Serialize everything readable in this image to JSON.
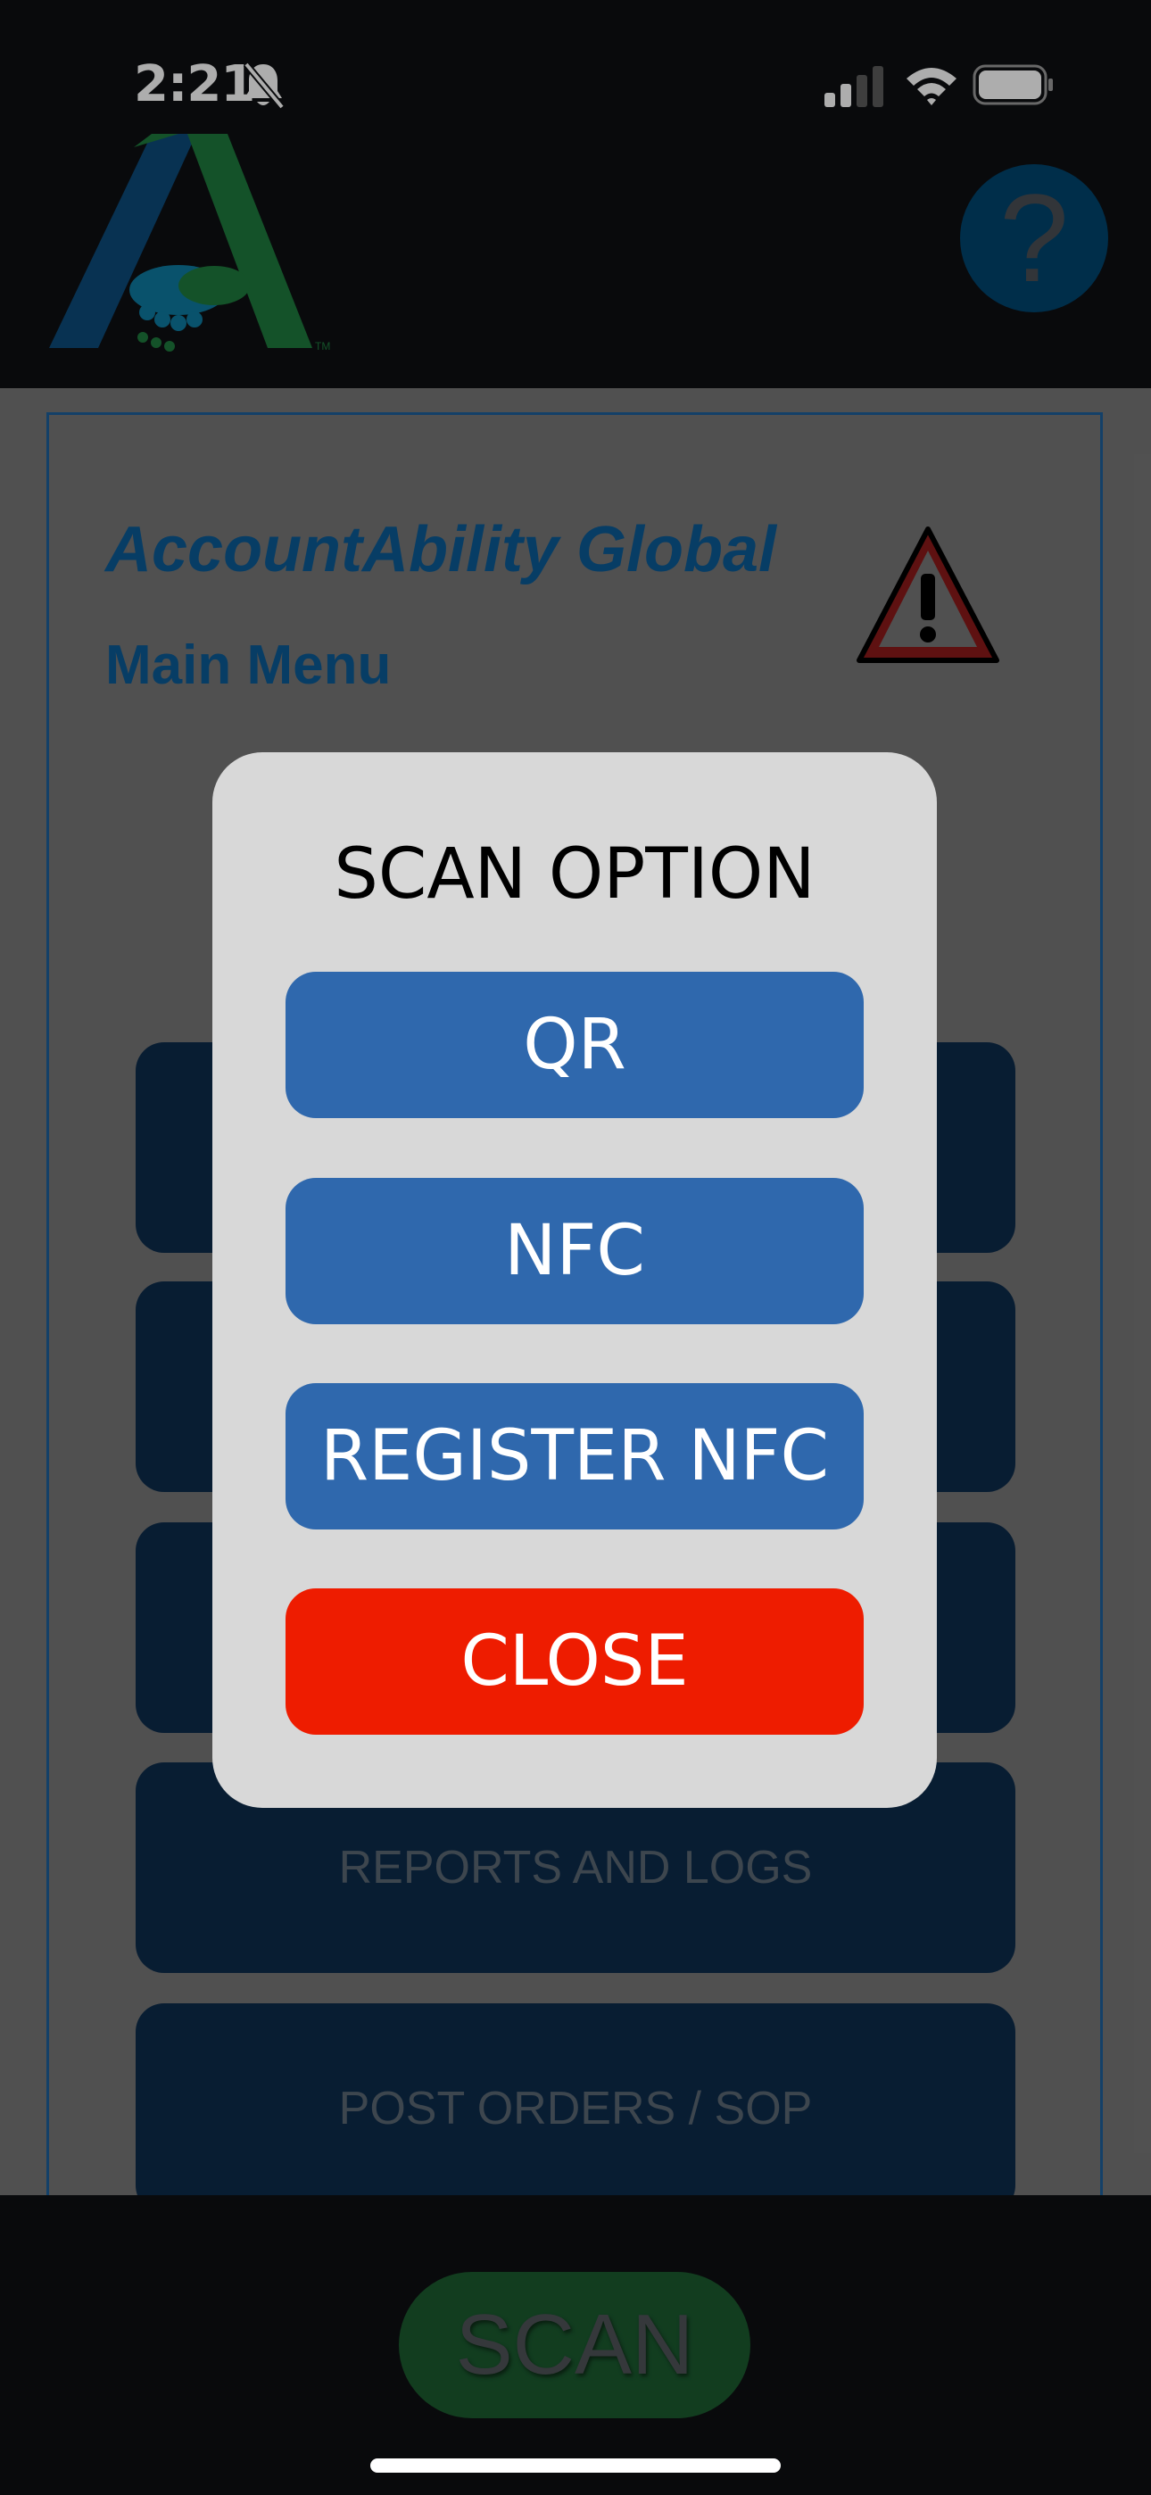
{
  "status_bar": {
    "time": "2:21",
    "icons": [
      "bell-slash-icon",
      "signal-icon",
      "wifi-icon",
      "battery-icon"
    ]
  },
  "header": {
    "logo": "accountability-logo",
    "help_label": "?"
  },
  "main": {
    "app_title": "AccountAbility Global",
    "menu_title": "Main Menu",
    "warning_icon": "warning-icon",
    "menu_items": [
      {
        "label": ""
      },
      {
        "label": ""
      },
      {
        "label": ""
      },
      {
        "label": "REPORTS AND LOGS"
      },
      {
        "label": "POST ORDERS / SOP"
      }
    ]
  },
  "modal": {
    "title": "SCAN OPTION",
    "buttons": [
      {
        "label": "QR"
      },
      {
        "label": "NFC"
      },
      {
        "label": "REGISTER NFC"
      },
      {
        "label": "CLOSE"
      }
    ]
  },
  "footer": {
    "scan_label": "SCAN"
  },
  "colors": {
    "brand_blue": "#0b5a96",
    "menu_button": "#0d2b4b",
    "modal_button": "#2f68ad",
    "close_button": "#ee1c00",
    "scan_button": "#1b5a2f"
  }
}
